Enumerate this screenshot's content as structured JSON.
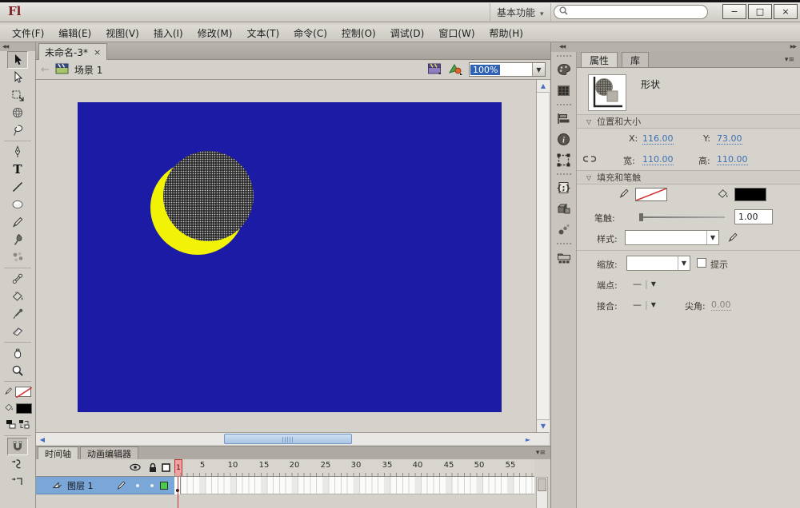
{
  "window": {
    "logo": "Fl",
    "workspace": "基本功能",
    "minimize": "−",
    "maximize": "□",
    "close": "×"
  },
  "menu": {
    "items": [
      "文件(F)",
      "编辑(E)",
      "视图(V)",
      "插入(I)",
      "修改(M)",
      "文本(T)",
      "命令(C)",
      "控制(O)",
      "调试(D)",
      "窗口(W)",
      "帮助(H)"
    ]
  },
  "document": {
    "tab_title": "未命名-3*",
    "tab_close": "×",
    "scene_label": "场景 1",
    "zoom_value": "100%"
  },
  "tools": [
    "selection",
    "subselection",
    "free-transform",
    "3d-rotation",
    "lasso",
    "pen",
    "text",
    "line",
    "oval",
    "pencil",
    "brush",
    "deco",
    "bone",
    "paint-bucket",
    "eyedropper",
    "eraser",
    "hand",
    "zoom",
    "stroke-color",
    "fill-color",
    "snap",
    "smooth",
    "straighten"
  ],
  "stage": {
    "background_color": "#1b1ba6",
    "moon_color": "#f2f207",
    "selected_fill_color": "#000000"
  },
  "timeline": {
    "tab_timeline": "时间轴",
    "tab_motion_editor": "动画编辑器",
    "layer_name": "图层 1",
    "current_frame": "1",
    "frame_numbers": [
      "5",
      "10",
      "15",
      "20",
      "25",
      "30",
      "35",
      "40",
      "45",
      "50",
      "55"
    ]
  },
  "properties": {
    "tab_properties": "属性",
    "tab_library": "库",
    "object_type": "形状",
    "section_position": "位置和大小",
    "x_label": "X:",
    "x_value": "116.00",
    "y_label": "Y:",
    "y_value": "73.00",
    "width_label": "宽:",
    "width_value": "110.00",
    "height_label": "高:",
    "height_value": "110.00",
    "section_fill": "填充和笔触",
    "stroke_label": "笔触:",
    "stroke_value": "1.00",
    "style_label": "样式:",
    "scale_label": "缩放:",
    "hint_label": "提示",
    "cap_label": "端点:",
    "join_label": "接合:",
    "miter_label": "尖角:",
    "miter_value": "0.00"
  },
  "colors": {
    "layer_selected": "#7aa6d8",
    "value_link": "#3d6fb4",
    "playhead_red": "#c03030",
    "layer_outline_green": "#4cc84c"
  },
  "icons": {
    "caret": "▾",
    "dropdown": "▼",
    "section_open": "▽",
    "menu_lines": "≡",
    "collapse_left": "◀◀",
    "collapse_right": "▶▶",
    "dash": "—",
    "pipe": "|",
    "scroll_up": "▲",
    "scroll_down": "▼",
    "scroll_left": "◀",
    "scroll_right": "►",
    "back_arrow": "←",
    "text_tool": "T"
  }
}
